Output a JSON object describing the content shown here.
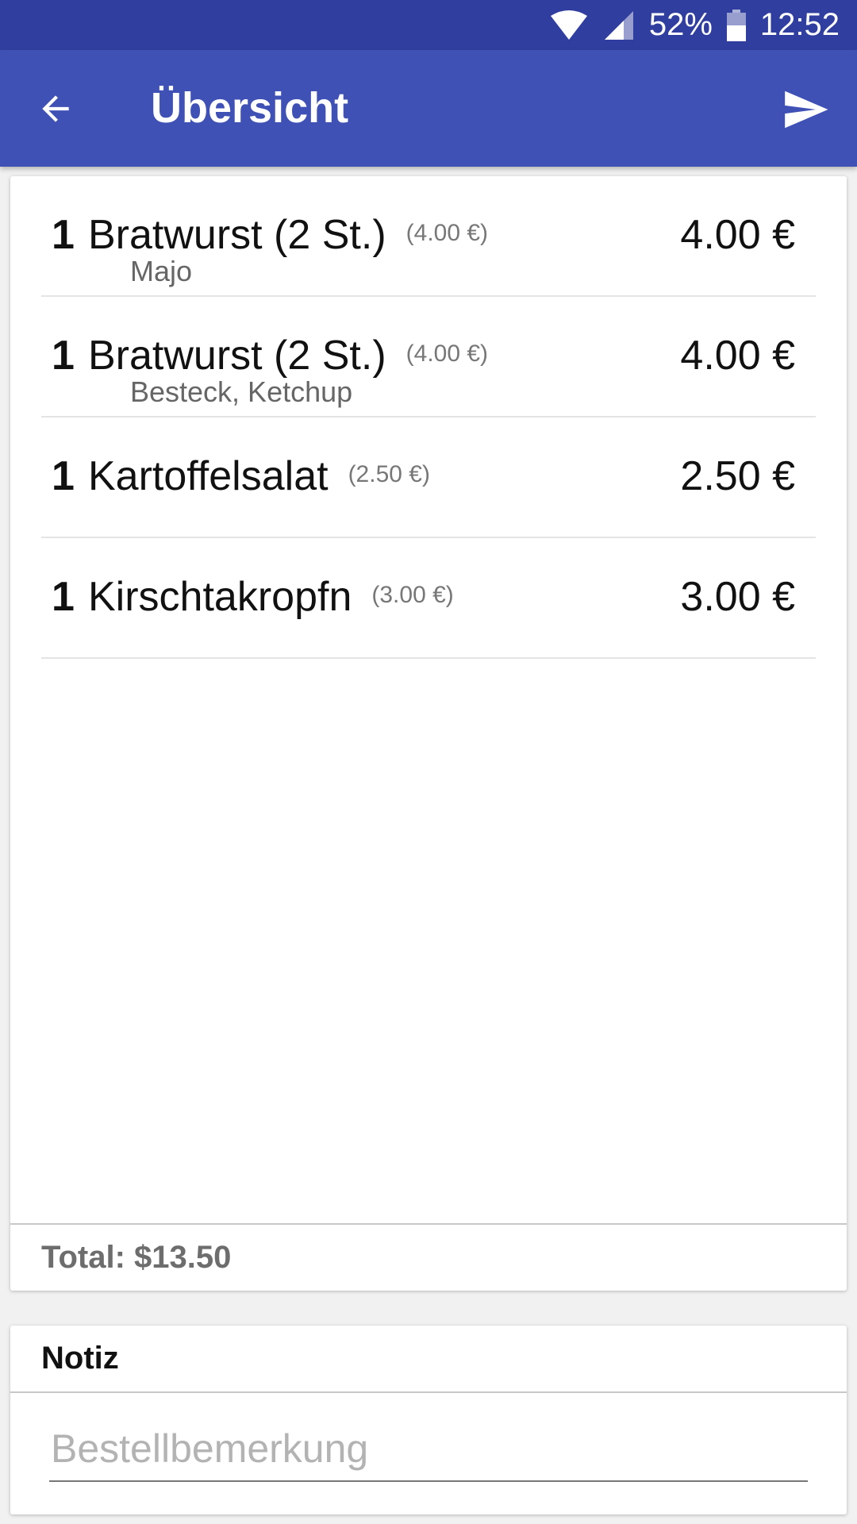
{
  "status_bar": {
    "battery": "52%",
    "time": "12:52"
  },
  "app_bar": {
    "title": "Übersicht",
    "back_icon": "arrow-back-icon",
    "send_icon": "send-icon"
  },
  "colors": {
    "status_bar": "#303f9f",
    "app_bar": "#3f51b5"
  },
  "order": {
    "items": [
      {
        "qty": "1",
        "name": "Bratwurst (2 St.)",
        "unit_price": "(4.00 €)",
        "extras": "Majo",
        "total": "4.00 €"
      },
      {
        "qty": "1",
        "name": "Bratwurst (2 St.)",
        "unit_price": "(4.00 €)",
        "extras": "Besteck, Ketchup",
        "total": "4.00 €"
      },
      {
        "qty": "1",
        "name": "Kartoffelsalat",
        "unit_price": "(2.50 €)",
        "extras": "",
        "total": "2.50 €"
      },
      {
        "qty": "1",
        "name": "Kirschtakropfn",
        "unit_price": "(3.00 €)",
        "extras": "",
        "total": "3.00 €"
      }
    ],
    "total_label": "Total: $13.50"
  },
  "note": {
    "title": "Notiz",
    "placeholder": "Bestellbemerkung",
    "value": ""
  }
}
